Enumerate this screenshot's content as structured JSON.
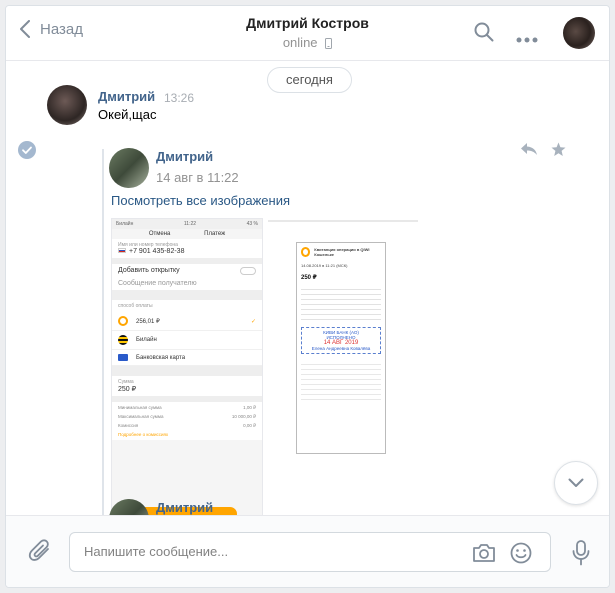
{
  "header": {
    "back_label": "Назад",
    "title": "Дмитрий Костров",
    "status": "online"
  },
  "date_separator": "сегодня",
  "message": {
    "author": "Дмитрий",
    "time": "13:26",
    "text": "Окей,щас"
  },
  "forwarded": {
    "author": "Дмитрий",
    "time": "14 авг в 11:22",
    "link": "Посмотреть все изображения",
    "next_author": "Дмитрий"
  },
  "screenshot_payment": {
    "carrier": "Билайн",
    "clock": "11:22",
    "battery": "43 %",
    "tab_cancel": "Отмена",
    "tab_payment": "Платеж",
    "phone_label": "Имя или номер телефона",
    "phone": "+7 901 435-82-38",
    "add_card": "Добавить открытку",
    "recipient_msg": "Сообщение получателю",
    "method_label": "способ оплаты",
    "method_qiwi": "256,01 ₽",
    "method_beeline": "Билайн",
    "method_card": "Банковская карта",
    "sum_label": "Сумма",
    "sum_value": "250 ₽",
    "min_label": "Минимальная сумма",
    "min_value": "1,00 ₽",
    "max_label": "Максимальная сумма",
    "max_value": "10 000,00 ₽",
    "fee_label": "Комиссия",
    "fee_value": "0,00 ₽",
    "details": "Подробнее о комиссиях"
  },
  "screenshot_receipt": {
    "heading": "Квитанция операции в QIWI Кошельке",
    "date": "14.08.2019 в 11:21 (МСК)",
    "amount": "250 ₽",
    "stamp_bank": "КИВИ БАНК (АО)",
    "stamp_status": "ИСПОЛНЕНО",
    "stamp_date": "14 АВГ 2019",
    "stamp_sign": "Елена Андреевна Ковалёва"
  },
  "composer": {
    "placeholder": "Напишите сообщение..."
  },
  "colors": {
    "link": "#2a5885",
    "author": "#42648b",
    "muted": "#939393",
    "accent_orange": "#ffa500"
  }
}
